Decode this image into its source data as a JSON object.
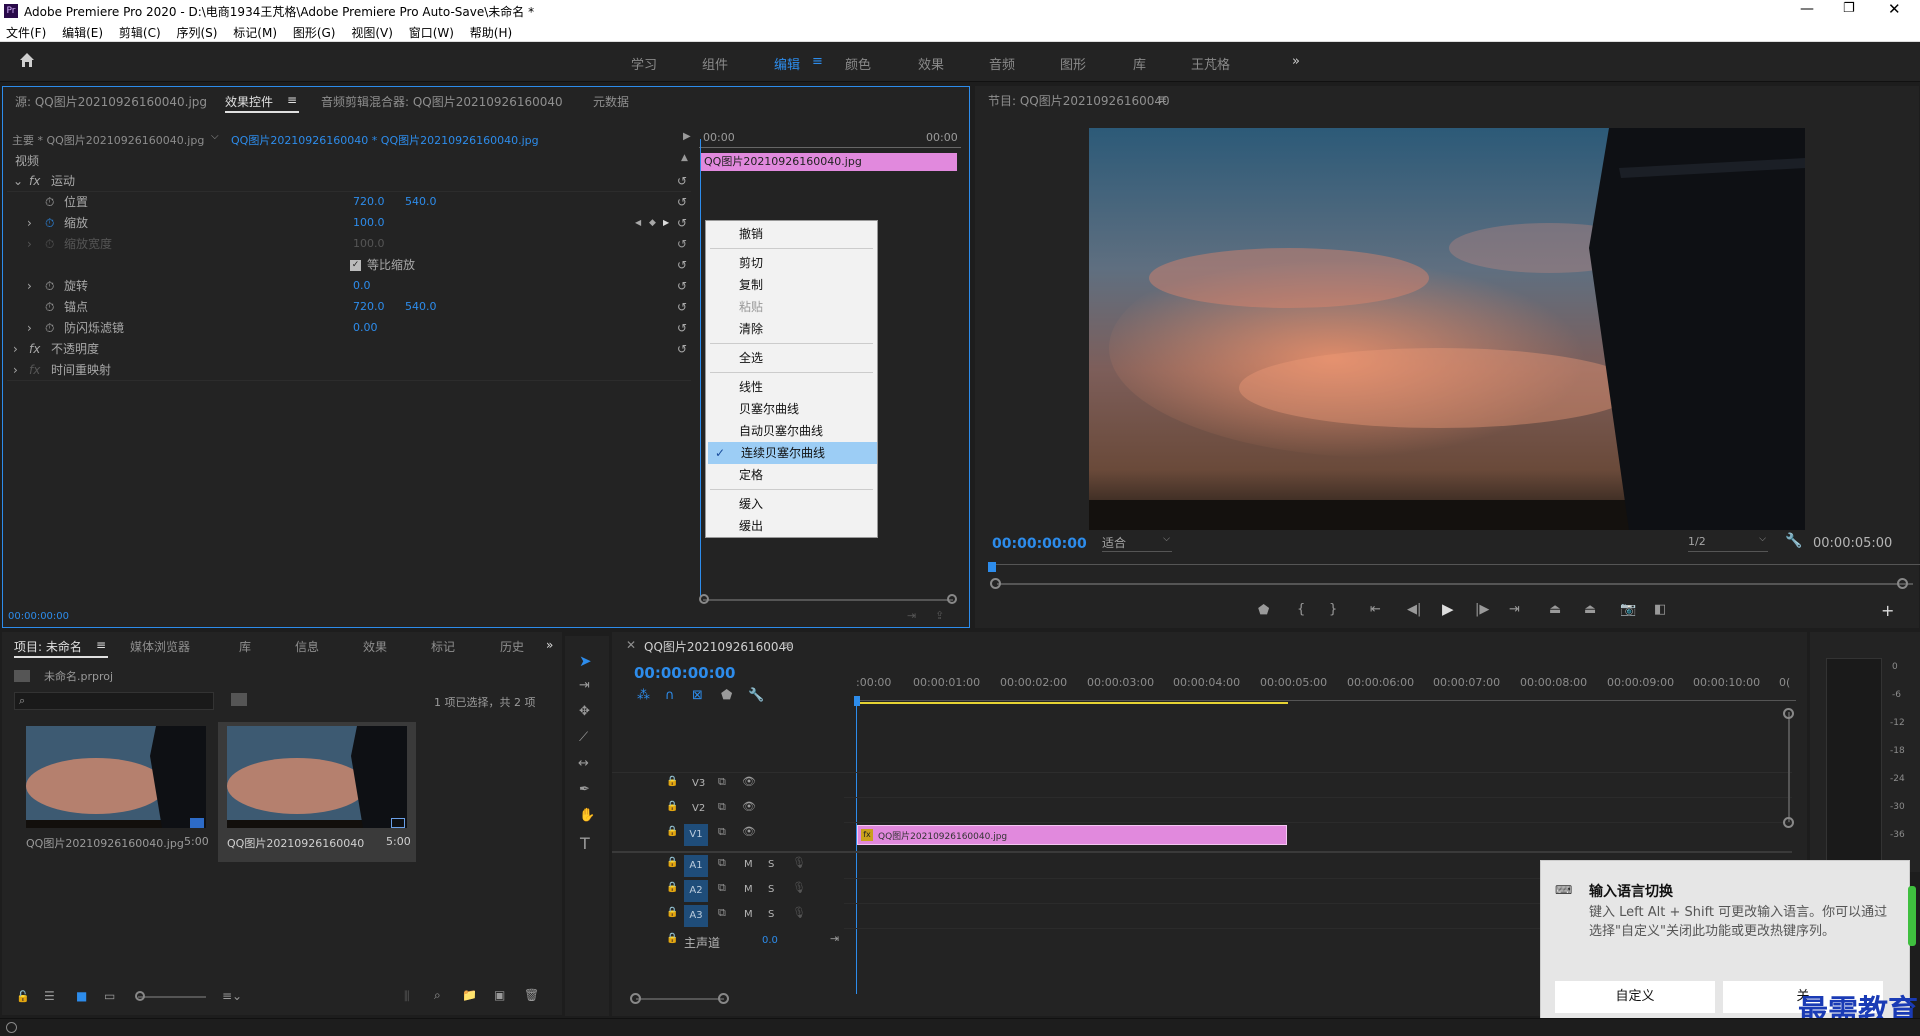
{
  "titlebar": {
    "title": "Adobe Premiere Pro 2020 - D:\\电商1934王芃格\\Adobe Premiere Pro Auto-Save\\未命名 *"
  },
  "menubar": [
    "文件(F)",
    "编辑(E)",
    "剪辑(C)",
    "序列(S)",
    "标记(M)",
    "图形(G)",
    "视图(V)",
    "窗口(W)",
    "帮助(H)"
  ],
  "workspaces": [
    "学习",
    "组件",
    "编辑",
    "颜色",
    "效果",
    "音频",
    "图形",
    "库",
    "王芃格"
  ],
  "workspaces_active": "编辑",
  "source_panel": {
    "tabs": [
      "源: QQ图片20210926160040.jpg",
      "效果控件",
      "音频剪辑混合器: QQ图片20210926160040",
      "元数据"
    ],
    "master_label": "主要 * QQ图片20210926160040.jpg",
    "clip_label": "QQ图片20210926160040 * QQ图片20210926160040.jpg",
    "ruler_start": "00:00",
    "ruler_end": "00:00",
    "clip_bar": "QQ图片20210926160040.jpg",
    "section_video": "视频",
    "rows": [
      {
        "name": "运动",
        "v1": "",
        "v2": ""
      },
      {
        "name": "位置",
        "v1": "720.0",
        "v2": "540.0"
      },
      {
        "name": "缩放",
        "v1": "100.0",
        "v2": ""
      },
      {
        "name": "缩放宽度",
        "v1": "100.0",
        "v2": ""
      },
      {
        "name": "等比缩放",
        "v1": "",
        "v2": ""
      },
      {
        "name": "旋转",
        "v1": "0.0",
        "v2": ""
      },
      {
        "name": "锚点",
        "v1": "720.0",
        "v2": "540.0"
      },
      {
        "name": "防闪烁滤镜",
        "v1": "0.00",
        "v2": ""
      },
      {
        "name": "不透明度",
        "v1": "",
        "v2": ""
      },
      {
        "name": "时间重映射",
        "v1": "",
        "v2": ""
      }
    ],
    "timecode": "00:00:00:00"
  },
  "context_menu": {
    "items": [
      "撤销",
      "剪切",
      "复制",
      "粘贴",
      "清除",
      "全选",
      "线性",
      "贝塞尔曲线",
      "自动贝塞尔曲线",
      "连续贝塞尔曲线",
      "定格",
      "缓入",
      "缓出"
    ],
    "checked": "连续贝塞尔曲线"
  },
  "program_panel": {
    "title": "节目: QQ图片20210926160040",
    "timecode": "00:00:00:00",
    "fit": "适合",
    "resolution": "1/2",
    "duration": "00:00:05:00"
  },
  "project_panel": {
    "tabs": [
      "项目: 未命名",
      "媒体浏览器",
      "库",
      "信息",
      "效果",
      "标记",
      "历史"
    ],
    "file": "未命名.prproj",
    "selection": "1 项已选择，共 2 项",
    "items": [
      {
        "name": "QQ图片20210926160040.jpg",
        "dur": "5:00"
      },
      {
        "name": "QQ图片20210926160040",
        "dur": "5:00"
      }
    ]
  },
  "timeline": {
    "title": "QQ图片20210926160040",
    "timecode": "00:00:00:00",
    "ruler": [
      ":00:00",
      "00:00:01:00",
      "00:00:02:00",
      "00:00:03:00",
      "00:00:04:00",
      "00:00:05:00",
      "00:00:06:00",
      "00:00:07:00",
      "00:00:08:00",
      "00:00:09:00",
      "00:00:10:00",
      "0("
    ],
    "video_tracks": [
      "V3",
      "V2",
      "V1"
    ],
    "audio_tracks": [
      "A1",
      "A2",
      "A3"
    ],
    "master": "主声道",
    "master_val": "0.0",
    "clip": "QQ图片20210926160040.jpg",
    "m_label": "M",
    "s_label": "S"
  },
  "meter": {
    "ticks": [
      "0",
      "-6",
      "-12",
      "-18",
      "-24",
      "-30",
      "-36"
    ]
  },
  "notification": {
    "title": "输入语言切换",
    "body": "键入 Left Alt + Shift 可更改输入语言。你可以通过选择\"自定义\"关闭此功能或更改热键序列。",
    "button": "自定义",
    "button2": "关"
  },
  "watermark": "最需教育"
}
